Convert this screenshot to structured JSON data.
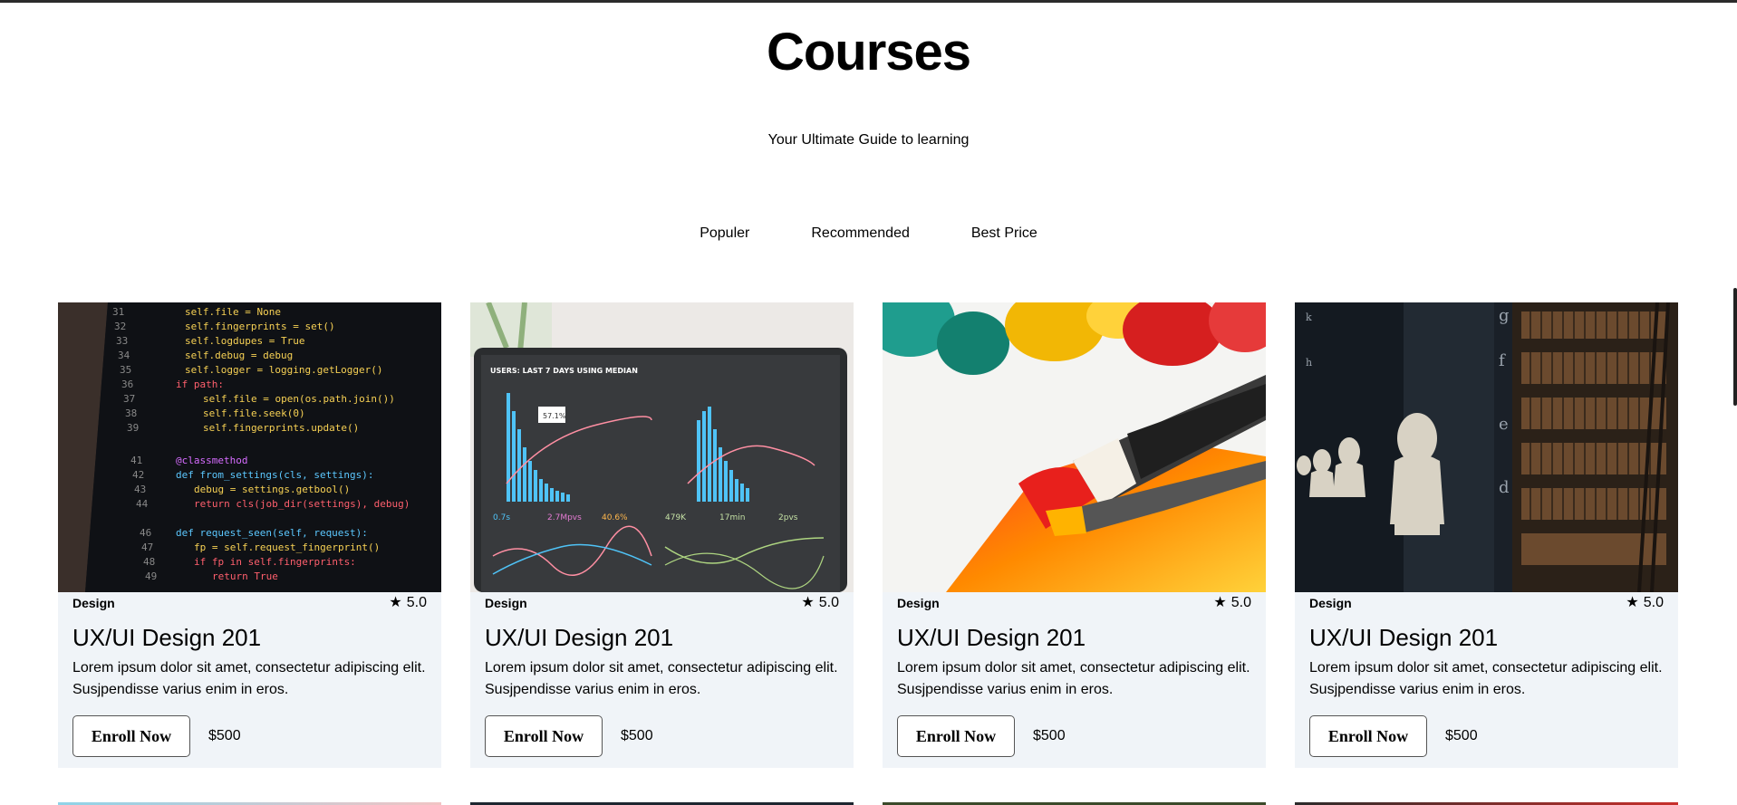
{
  "header": {
    "title": "Courses",
    "subtitle": "Your Ultimate Guide to learning"
  },
  "filters": [
    {
      "label": "Populer"
    },
    {
      "label": "Recommended"
    },
    {
      "label": "Best Price"
    }
  ],
  "courses": [
    {
      "image": "code-editor-photo",
      "category": "Design",
      "rating": "5.0",
      "title": "UX/UI Design 201",
      "description": "Lorem ipsum dolor sit amet, consectetur adipiscing elit. Susjpendisse varius enim in eros.",
      "enroll_label": "Enroll Now",
      "price": "$500"
    },
    {
      "image": "analytics-dashboard-photo",
      "category": "Design",
      "rating": "5.0",
      "title": "UX/UI Design 201",
      "description": "Lorem ipsum dolor sit amet, consectetur adipiscing elit. Susjpendisse varius enim in eros.",
      "enroll_label": "Enroll Now",
      "price": "$500"
    },
    {
      "image": "paint-brush-photo",
      "category": "Design",
      "rating": "5.0",
      "title": "UX/UI Design 201",
      "description": "Lorem ipsum dolor sit amet, consectetur adipiscing elit. Susjpendisse varius enim in eros.",
      "enroll_label": "Enroll Now",
      "price": "$500"
    },
    {
      "image": "library-busts-photo",
      "category": "Design",
      "rating": "5.0",
      "title": "UX/UI Design 201",
      "description": "Lorem ipsum dolor sit amet, consectetur adipiscing elit. Susjpendisse varius enim in eros.",
      "enroll_label": "Enroll Now",
      "price": "$500"
    }
  ],
  "icons": {
    "rating": "star-icon"
  },
  "colors": {
    "card_background": "#f0f4f8",
    "page_background": "#ffffff"
  }
}
